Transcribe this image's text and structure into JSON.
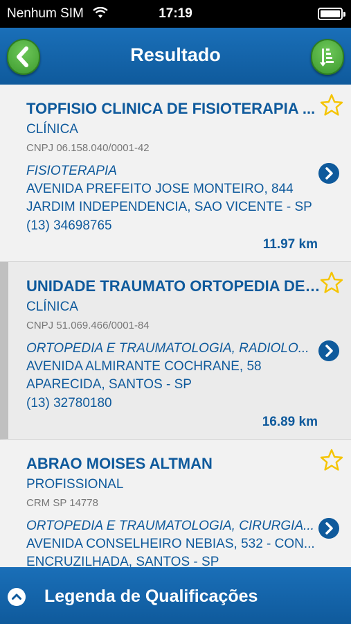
{
  "status_bar": {
    "carrier": "Nenhum SIM",
    "time": "17:19"
  },
  "nav": {
    "title": "Resultado"
  },
  "results": [
    {
      "name": "TOPFISIO CLINICA DE FISIOTERAPIA ...",
      "type": "CLÍNICA",
      "registration": "CNPJ 06.158.040/0001-42",
      "specialty": "FISIOTERAPIA",
      "address_line1": "AVENIDA PREFEITO JOSE MONTEIRO, 844",
      "address_line2": "JARDIM INDEPENDENCIA, SAO VICENTE - SP",
      "phone": "(13) 34698765",
      "distance": "11.97 km"
    },
    {
      "name": "UNIDADE TRAUMATO ORTOPEDIA DE ...",
      "type": "CLÍNICA",
      "registration": "CNPJ 51.069.466/0001-84",
      "specialty": "ORTOPEDIA E TRAUMATOLOGIA, RADIOLO...",
      "address_line1": "AVENIDA ALMIRANTE COCHRANE, 58",
      "address_line2": "APARECIDA, SANTOS - SP",
      "phone": "(13) 32780180",
      "distance": "16.89 km"
    },
    {
      "name": "ABRAO MOISES ALTMAN",
      "type": "PROFISSIONAL",
      "registration": "CRM SP 14778",
      "specialty": "ORTOPEDIA E TRAUMATOLOGIA, CIRURGIA...",
      "address_line1": "AVENIDA CONSELHEIRO NEBIAS, 532 - CON...",
      "address_line2": "ENCRUZILHADA, SANTOS - SP",
      "phone": "",
      "distance": ""
    }
  ],
  "footer": {
    "label": "Legenda de Qualificações"
  },
  "colors": {
    "primary_blue": "#0f5a9c",
    "button_green": "#4caf3c",
    "star_yellow": "#f5c400"
  }
}
